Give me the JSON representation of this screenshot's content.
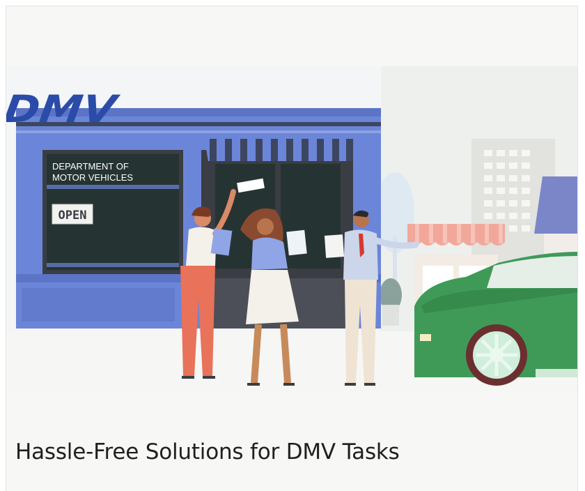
{
  "card": {
    "title": "Hassle-Free Solutions for DMV Tasks"
  },
  "illustration": {
    "logo_text": "DMV",
    "window_sign": [
      "DEPARTMENT OF",
      "MOTOR VEHICLES"
    ],
    "open_sign": "OPEN",
    "colors": {
      "building": "#6b86d8",
      "logo": "#2b4ba8",
      "car": "#3f9a58",
      "awning_red": "#f2a79b"
    }
  }
}
